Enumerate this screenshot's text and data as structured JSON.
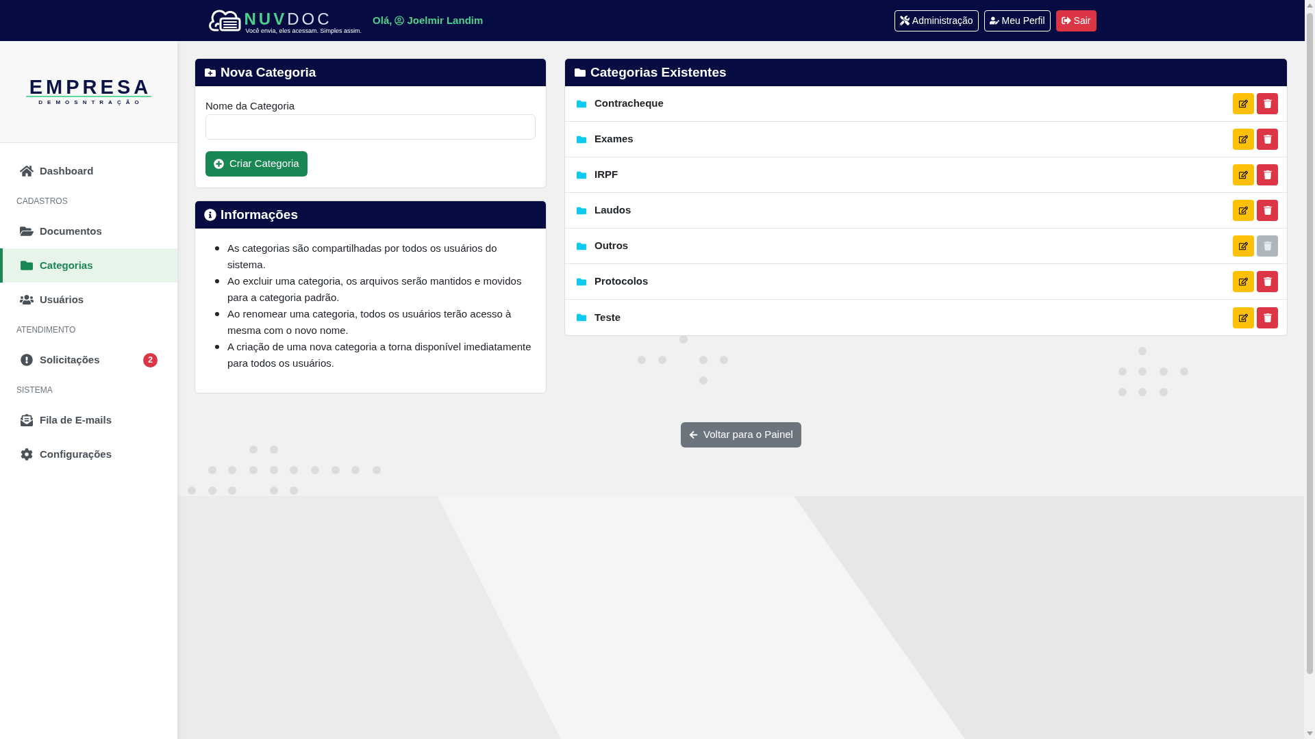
{
  "top_bar": {
    "brand": {
      "name_strong": "NUV",
      "name_light": "DOC",
      "tagline": "Você envia, eles acessam. Simples assim."
    },
    "greeting": "Olá,",
    "user_name": "Joelmir Landim",
    "buttons": [
      {
        "label": "Administração",
        "kind": "outline"
      },
      {
        "label": "Meu Perfil",
        "kind": "outline"
      },
      {
        "label": "Sair",
        "kind": "danger"
      }
    ]
  },
  "sidebar": {
    "logo": {
      "name": "EMPRESA",
      "tagline": "DEMOSNTRAÇÃO"
    },
    "nav": [
      {
        "kind": "item",
        "label": "Dashboard",
        "selected": false
      },
      {
        "kind": "section",
        "label": "CADASTROS"
      },
      {
        "kind": "item",
        "label": "Documentos",
        "selected": false
      },
      {
        "kind": "item",
        "label": "Categorias",
        "selected": true
      },
      {
        "kind": "item",
        "label": "Usuários",
        "selected": false
      },
      {
        "kind": "section",
        "label": "ATENDIMENTO"
      },
      {
        "kind": "item",
        "label": "Solicitações",
        "selected": false,
        "badge": "2"
      },
      {
        "kind": "section",
        "label": "SISTEMA"
      },
      {
        "kind": "item",
        "label": "Fila de E-mails",
        "selected": false
      },
      {
        "kind": "item",
        "label": "Configurações",
        "selected": false
      }
    ]
  },
  "new_category": {
    "title": "Nova Categoria",
    "field_label": "Nome da Categoria",
    "button": "Criar Categoria"
  },
  "info": {
    "title": "Informações",
    "items": [
      "As categorias são compartilhadas por todos os usuários do sistema.",
      "Ao excluir uma categoria, os arquivos serão mantidos e movidos para a categoria padrão.",
      "Ao renomear uma categoria, todos os usuários terão acesso à mesma com o novo nome.",
      "A criação de uma nova categoria a torna disponível imediatamente para todos os usuários."
    ]
  },
  "categories": {
    "title": "Categorias Existentes",
    "rows": [
      {
        "name": "Contracheque",
        "delete_disabled": false
      },
      {
        "name": "Exames",
        "delete_disabled": false
      },
      {
        "name": "IRPF",
        "delete_disabled": false
      },
      {
        "name": "Laudos",
        "delete_disabled": false
      },
      {
        "name": "Outros",
        "delete_disabled": true
      },
      {
        "name": "Protocolos",
        "delete_disabled": false
      },
      {
        "name": "Teste",
        "delete_disabled": false
      }
    ]
  },
  "back_button": "Voltar para o Painel"
}
